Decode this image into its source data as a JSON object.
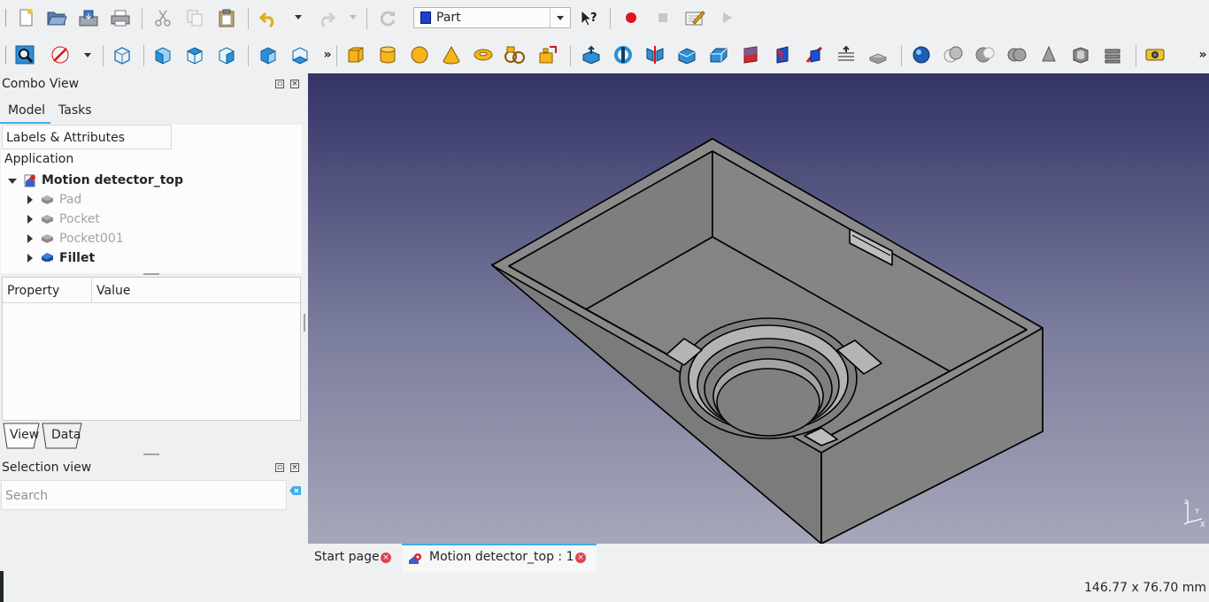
{
  "toolbar": {
    "workbench": "Part",
    "icons_row1": [
      "new-icon",
      "open-icon",
      "save-icon",
      "print-icon",
      "cut-icon",
      "copy-icon",
      "paste-icon",
      "undo-icon",
      "redo-icon",
      "refresh-icon",
      "whats-this-icon",
      "record-macro-icon",
      "stop-macro-icon",
      "edit-macro-icon",
      "run-macro-icon"
    ],
    "icons_row2": [
      "fit-all-icon",
      "draw-style-icon",
      "isometric-icon",
      "front-view-icon",
      "top-view-icon",
      "right-view-icon",
      "rear-view-icon",
      "bottom-view-icon",
      "box-icon",
      "cylinder-icon",
      "sphere-icon",
      "cone-icon",
      "torus-icon",
      "tube-icon",
      "primitives-icon",
      "extrude-icon",
      "revolve-icon",
      "mirror-icon",
      "fillet-icon",
      "chamfer-icon",
      "make-face-icon",
      "ruled-surface-icon",
      "loft-icon",
      "sweep-icon",
      "section-icon",
      "cross-sections-icon",
      "compound-icon",
      "boolean-icon",
      "cut-icon",
      "fuse-icon",
      "common-icon",
      "thickness-icon",
      "offset-icon",
      "measure-icon"
    ]
  },
  "combo_view": {
    "title": "Combo View",
    "tabs": [
      "Model",
      "Tasks"
    ],
    "labels_header": "Labels & Attributes",
    "application": "Application",
    "document": "Motion detector_top",
    "features": [
      {
        "label": "Pad",
        "hidden": true
      },
      {
        "label": "Pocket",
        "hidden": true
      },
      {
        "label": "Pocket001",
        "hidden": true
      },
      {
        "label": "Fillet",
        "hidden": false
      }
    ],
    "property_header": "Property",
    "value_header": "Value",
    "view_tab": "View",
    "data_tab": "Data"
  },
  "selection_view": {
    "title": "Selection view",
    "search_placeholder": "Search"
  },
  "doc_tabs": {
    "start_page": "Start page",
    "document_view": "Motion detector_top : 1"
  },
  "status": {
    "dimensions": "146.77 x 76.70 mm"
  },
  "colors": {
    "background_top": "#333366",
    "background_bottom": "#a6a7b9",
    "model_gray": "#838383",
    "accent": "#3daee9"
  }
}
